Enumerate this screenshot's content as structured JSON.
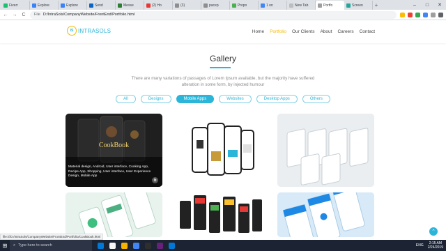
{
  "browser": {
    "tabs": [
      {
        "label": "Fiverr",
        "color": "#1dbf73"
      },
      {
        "label": "Explore",
        "color": "#3b82f6"
      },
      {
        "label": "Explore",
        "color": "#3b82f6"
      },
      {
        "label": "Send",
        "color": "#0a66c2"
      },
      {
        "label": "Messe",
        "color": "#2e7d32"
      },
      {
        "label": "(2) Ho",
        "color": "#e53935"
      },
      {
        "label": "(3)",
        "color": "#8e8e8e"
      },
      {
        "label": "pacep",
        "color": "#8e8e8e"
      },
      {
        "label": "Propo",
        "color": "#4caf50"
      },
      {
        "label": "1 on",
        "color": "#4285f4"
      },
      {
        "label": "New Tab",
        "color": "#bdbdbd"
      },
      {
        "label": "Portfo",
        "color": "#9e9e9e",
        "active": true
      },
      {
        "label": "Screen",
        "color": "#26a69a"
      }
    ],
    "new_tab": "+",
    "win": {
      "minimize": "–",
      "maximize": "□",
      "close": "✕"
    },
    "nav": {
      "back": "←",
      "forward": "→",
      "reload": "C"
    },
    "address": {
      "scheme_label": "File",
      "url": "D:/IntraSols/CompanyWebsite/FrontEnd/Portfolio.html"
    },
    "ext_colors": [
      "#fbbc04",
      "#ea4335",
      "#34a853",
      "#4285f4",
      "#9e9e9e",
      "#5f6368"
    ]
  },
  "site": {
    "logo_mark": "IS",
    "logo_text": "INTRASOLS",
    "nav": [
      {
        "label": "Home"
      },
      {
        "label": "Portfolio",
        "active": true
      },
      {
        "label": "Our Clients"
      },
      {
        "label": "About"
      },
      {
        "label": "Careers"
      },
      {
        "label": "Contact"
      }
    ]
  },
  "gallery": {
    "title": "Gallery",
    "intro": "There are many variations of passages of Lorem Ipsum available, but the majority have suffered alteration in some form, by injected humour",
    "filters": [
      {
        "label": "All"
      },
      {
        "label": "Designs"
      },
      {
        "label": "Mobile Apps",
        "active": true
      },
      {
        "label": "Websites"
      },
      {
        "label": "Desktop Apps"
      },
      {
        "label": "Others"
      }
    ],
    "hover_card": {
      "overlay_title": "CookBook",
      "caption": "Material design, Android, User interface, Cooking App, Recipe App, Shopping, User interface, User Experience Design, Mobile App"
    }
  },
  "statusbar": {
    "link": "file:///D:/IntraSols/CompanyWebsite/FrontEnd/Portfolio/CookBook.html"
  },
  "taskbar": {
    "search_placeholder": "Type here to search",
    "icons": [
      "#0078d7",
      "#f5f5f5",
      "#f4b400",
      "#4285f4",
      "#2e2e2e",
      "#68217a",
      "#0078d7"
    ],
    "lang": "ENG",
    "time": "2:15 AM",
    "date": "2/24/2019"
  }
}
